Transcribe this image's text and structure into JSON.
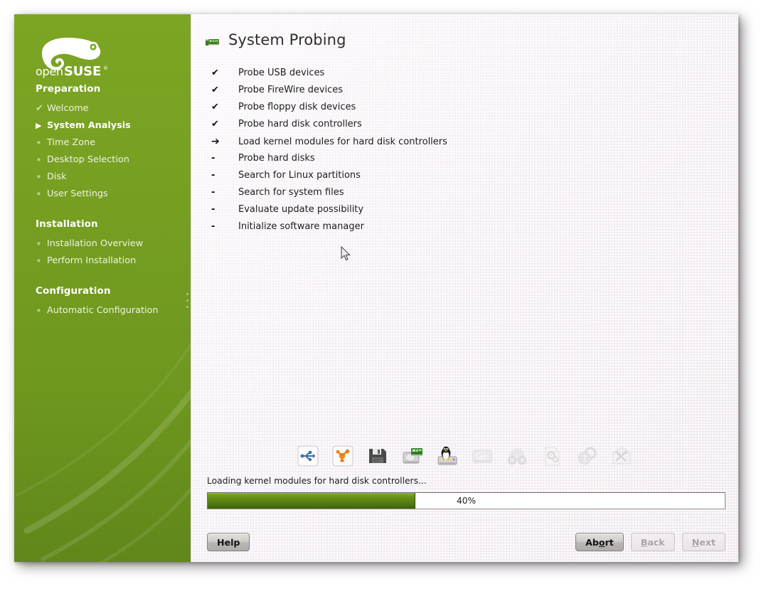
{
  "window": {
    "title": "System Probing",
    "title_icon": "pci-card-icon"
  },
  "sidebar": {
    "logo": {
      "icon": "opensuse-geeko-logo",
      "word_light": "open",
      "word_bold": "SUSE",
      "trademark": "®"
    },
    "groups": [
      {
        "title": "Preparation",
        "items": [
          {
            "label": "Welcome",
            "marker": "check",
            "state": "done"
          },
          {
            "label": "System Analysis",
            "marker": "arrow",
            "state": "current"
          },
          {
            "label": "Time Zone",
            "marker": "dot",
            "state": "pending"
          },
          {
            "label": "Desktop Selection",
            "marker": "dot",
            "state": "pending"
          },
          {
            "label": "Disk",
            "marker": "dot",
            "state": "pending"
          },
          {
            "label": "User Settings",
            "marker": "dot",
            "state": "pending"
          }
        ]
      },
      {
        "title": "Installation",
        "items": [
          {
            "label": "Installation Overview",
            "marker": "dot",
            "state": "pending"
          },
          {
            "label": "Perform Installation",
            "marker": "dot",
            "state": "pending"
          }
        ]
      },
      {
        "title": "Configuration",
        "items": [
          {
            "label": "Automatic Configuration",
            "marker": "dot",
            "state": "pending"
          }
        ]
      }
    ],
    "markers": {
      "check": "✔",
      "arrow": "▶",
      "dot": "•"
    }
  },
  "main": {
    "tasks": [
      {
        "status": "✔",
        "state": "done",
        "label": "Probe USB devices"
      },
      {
        "status": "✔",
        "state": "done",
        "label": "Probe FireWire devices"
      },
      {
        "status": "✔",
        "state": "done",
        "label": "Probe floppy disk devices"
      },
      {
        "status": "✔",
        "state": "done",
        "label": "Probe hard disk controllers"
      },
      {
        "status": "➔",
        "state": "current",
        "label": "Load kernel modules for hard disk controllers"
      },
      {
        "status": "-",
        "state": "pending",
        "label": "Probe hard disks"
      },
      {
        "status": "-",
        "state": "pending",
        "label": "Search for Linux partitions"
      },
      {
        "status": "-",
        "state": "pending",
        "label": "Search for system files"
      },
      {
        "status": "-",
        "state": "pending",
        "label": "Evaluate update possibility"
      },
      {
        "status": "-",
        "state": "pending",
        "label": "Initialize software manager"
      }
    ],
    "probe_icons": [
      {
        "name": "usb-icon",
        "active": true
      },
      {
        "name": "firewire-icon",
        "active": true
      },
      {
        "name": "floppy-disk-icon",
        "active": true
      },
      {
        "name": "hard-disk-controller-icon",
        "active": true
      },
      {
        "name": "linux-hard-disk-icon",
        "active": true
      },
      {
        "name": "hard-disk-icon",
        "active": false
      },
      {
        "name": "partition-search-icon",
        "active": false
      },
      {
        "name": "system-files-icon",
        "active": false
      },
      {
        "name": "update-check-icon",
        "active": false
      },
      {
        "name": "software-manager-icon",
        "active": false
      }
    ]
  },
  "progress": {
    "label": "Loading kernel modules for hard disk controllers...",
    "percent": 40,
    "percent_text": "40%",
    "fill_color": "#5c8414"
  },
  "buttons": {
    "help": {
      "label": "Help",
      "accel": "",
      "enabled": true
    },
    "abort": {
      "label": "Abort",
      "accel": "o",
      "enabled": true
    },
    "back": {
      "label": "Back",
      "accel": "B",
      "enabled": false
    },
    "next": {
      "label": "Next",
      "accel": "N",
      "enabled": false
    }
  },
  "theme": {
    "sidebar_green": "#78a222",
    "content_bg": "#f2eaf1",
    "progress_green": "#5c8414"
  }
}
